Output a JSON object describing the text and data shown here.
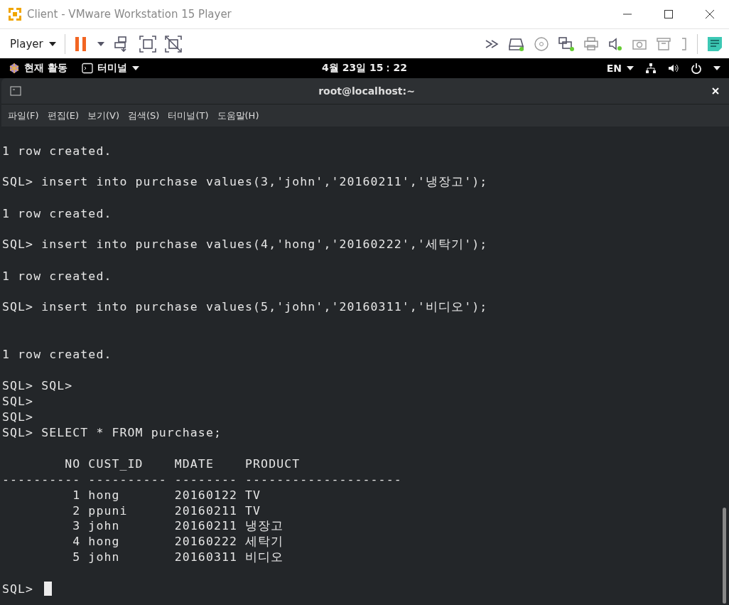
{
  "window": {
    "title": "Client - VMware Workstation 15 Player"
  },
  "toolbar": {
    "menu": "Player"
  },
  "top_bar": {
    "activities": "현재 활동",
    "app": "터미널",
    "clock": "4월 23일 15：22",
    "language": "EN"
  },
  "terminal": {
    "title": "root@localhost:~",
    "menu": [
      "파일(F)",
      "편집(E)",
      "보기(V)",
      "검색(S)",
      "터미널(T)",
      "도움말(H)"
    ],
    "lines": [
      {
        "kind": "text",
        "text": "1 row created."
      },
      {
        "kind": "blank"
      },
      {
        "kind": "text",
        "text": "SQL> insert into purchase values(3,'john','20160211','냉장고');"
      },
      {
        "kind": "blank"
      },
      {
        "kind": "text",
        "text": "1 row created."
      },
      {
        "kind": "blank"
      },
      {
        "kind": "text",
        "text": "SQL> insert into purchase values(4,'hong','20160222','세탁기');"
      },
      {
        "kind": "blank"
      },
      {
        "kind": "text",
        "text": "1 row created."
      },
      {
        "kind": "blank"
      },
      {
        "kind": "text",
        "text": "SQL> insert into purchase values(5,'john','20160311','비디오');"
      },
      {
        "kind": "blank"
      },
      {
        "kind": "blank"
      },
      {
        "kind": "text",
        "text": "1 row created."
      },
      {
        "kind": "blank"
      },
      {
        "kind": "text",
        "text": "SQL> SQL>"
      },
      {
        "kind": "text",
        "text": "SQL>"
      },
      {
        "kind": "text",
        "text": "SQL>"
      },
      {
        "kind": "text",
        "text": "SQL> SELECT * FROM purchase;"
      },
      {
        "kind": "blank"
      },
      {
        "kind": "text",
        "text": "        NO CUST_ID    MDATE    PRODUCT"
      },
      {
        "kind": "text",
        "text": "---------- ---------- -------- --------------------"
      },
      {
        "kind": "text",
        "text": "         1 hong       20160122 TV"
      },
      {
        "kind": "text",
        "text": "         2 ppuni      20160211 TV"
      },
      {
        "kind": "text",
        "text": "         3 john       20160211 냉장고"
      },
      {
        "kind": "text",
        "text": "         4 hong       20160222 세탁기"
      },
      {
        "kind": "text",
        "text": "         5 john       20160311 비디오"
      },
      {
        "kind": "blank"
      }
    ],
    "prompt": "SQL>"
  }
}
